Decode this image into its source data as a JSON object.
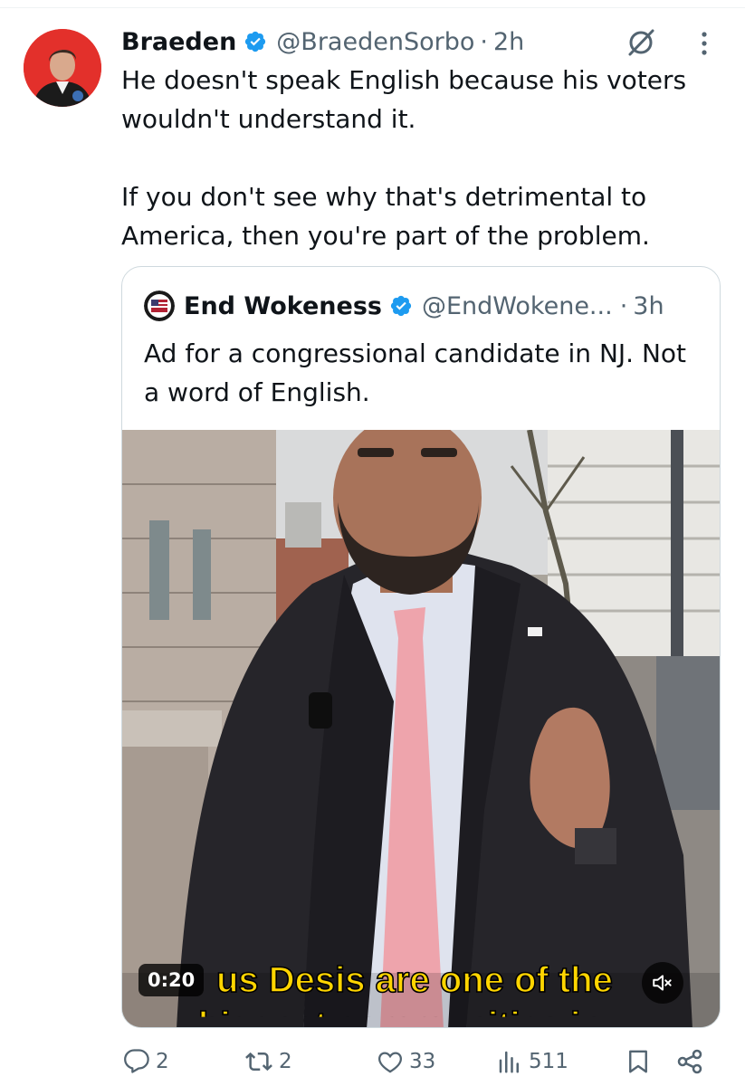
{
  "tweet": {
    "author_name": "Braeden",
    "author_handle": "@BraedenSorbo",
    "separator": "·",
    "time": "2h",
    "text": "He doesn't speak English because his voters wouldn't understand it.\n\nIf you don't see why that's detrimental to America, then you're part of the problem."
  },
  "quote": {
    "author_name": "End Wokeness",
    "author_handle": "@EndWokene...",
    "separator": "·",
    "time": "3h",
    "text": "Ad for a congressional candidate in NJ. Not a word of English.",
    "video": {
      "duration": "0:20",
      "caption_line1": "us Desis are one of the",
      "caption_line2": "biggest communities in"
    }
  },
  "actions": {
    "replies": "2",
    "reposts": "2",
    "likes": "33",
    "views": "511"
  },
  "colors": {
    "verified": "#1d9bf0",
    "secondary_text": "#536471",
    "caption_fill": "#ffd500",
    "avatar_bg": "#e3302b"
  },
  "icons": [
    "verified-badge-icon",
    "grok-icon",
    "more-icon",
    "reply-icon",
    "repost-icon",
    "like-icon",
    "views-icon",
    "bookmark-icon",
    "share-icon",
    "mute-icon"
  ]
}
